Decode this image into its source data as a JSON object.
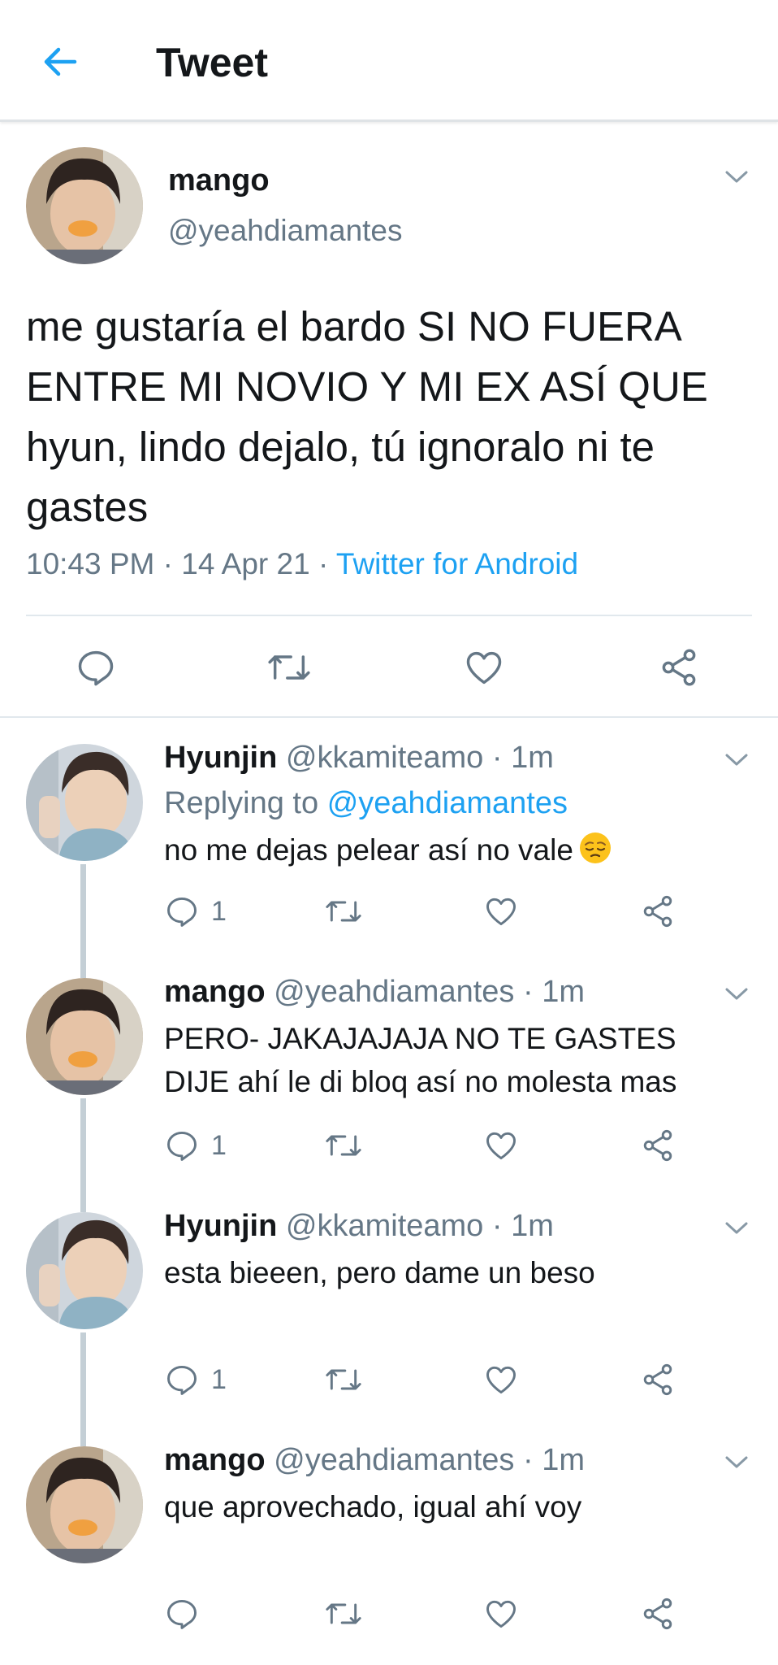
{
  "header": {
    "title": "Tweet",
    "back_icon": "arrow-left-icon",
    "accent": "#1da1f2"
  },
  "main_tweet": {
    "name": "mango",
    "handle": "@yeahdiamantes",
    "text": "me gustaría el bardo SI NO FUERA ENTRE MI NOVIO Y MI EX ASÍ QUE hyun, lindo dejalo, tú ignoralo ni te gastes",
    "time": "10:43 PM",
    "date": "14 Apr 21",
    "source": "Twitter for Android",
    "sep": "·"
  },
  "replies": [
    {
      "name": "Hyunjin",
      "handle": "@kkamiteamo",
      "sep": "·",
      "time": "1m",
      "replying_label": "Replying to",
      "replying_to": "@yeahdiamantes",
      "text": "no me dejas pelear así no vale",
      "emoji": "pensive-face-emoji",
      "reply_count": "1"
    },
    {
      "name": "mango",
      "handle": "@yeahdiamantes",
      "sep": "·",
      "time": "1m",
      "text": "PERO- JAKAJAJAJA NO TE GASTES DIJE ahí le di bloq así no molesta mas",
      "reply_count": "1"
    },
    {
      "name": "Hyunjin",
      "handle": "@kkamiteamo",
      "sep": "·",
      "time": "1m",
      "text": "esta bieeen, pero dame un beso",
      "reply_count": "1"
    },
    {
      "name": "mango",
      "handle": "@yeahdiamantes",
      "sep": "·",
      "time": "1m",
      "text": "que aprovechado, igual ahí voy",
      "reply_count": ""
    }
  ],
  "colors": {
    "text": "#14171a",
    "secondary": "#657786",
    "link": "#1da1f2",
    "thread": "#c4cfd6"
  }
}
